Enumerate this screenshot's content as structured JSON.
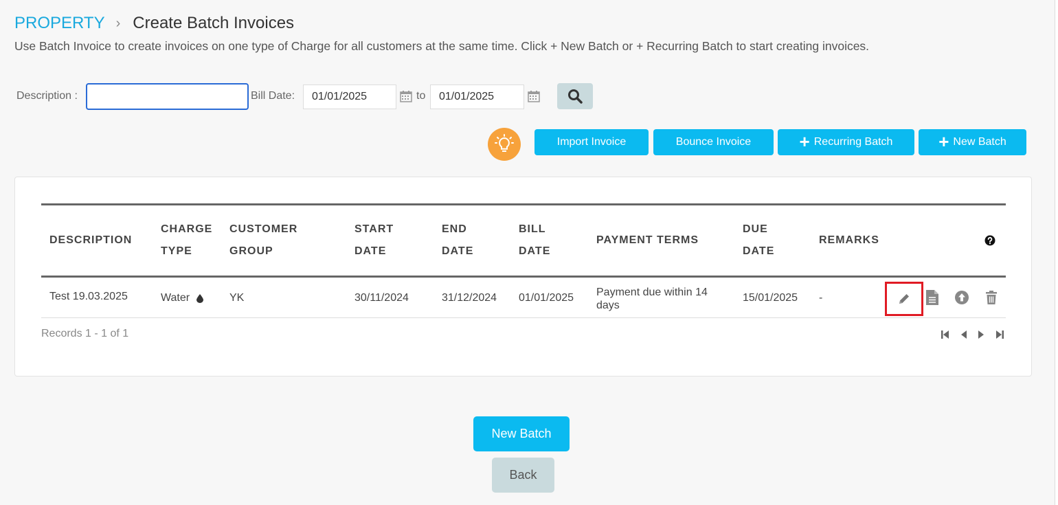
{
  "breadcrumb": {
    "root": "PROPERTY",
    "separator": "›",
    "current": "Create Batch Invoices"
  },
  "subtitle": "Use Batch Invoice to create invoices on one type of Charge for all customers at the same time. Click + New Batch or + Recurring Batch to start creating invoices.",
  "filters": {
    "description_label": "Description :",
    "description_value": "",
    "bill_date_label": "Bill Date:",
    "date_from": "01/01/2025",
    "to_label": "to",
    "date_to": "01/01/2025"
  },
  "toolbar": {
    "import_invoice": "Import Invoice",
    "bounce_invoice": "Bounce Invoice",
    "recurring_batch": "Recurring Batch",
    "new_batch": "New Batch"
  },
  "table": {
    "headers": {
      "description": "DESCRIPTION",
      "charge_type_1": "CHARGE",
      "charge_type_2": "TYPE",
      "customer_group_1": "CUSTOMER",
      "customer_group_2": "GROUP",
      "start_date_1": "START",
      "start_date_2": "DATE",
      "end_date_1": "END",
      "end_date_2": "DATE",
      "bill_date_1": "BILL",
      "bill_date_2": "DATE",
      "payment_terms": "PAYMENT TERMS",
      "due_date_1": "DUE",
      "due_date_2": "DATE",
      "remarks": "REMARKS"
    },
    "rows": [
      {
        "description": "Test 19.03.2025",
        "charge_type": "Water",
        "customer_group": "YK",
        "start_date": "30/11/2024",
        "end_date": "31/12/2024",
        "bill_date": "01/01/2025",
        "payment_terms_1": "Payment due within 14",
        "payment_terms_2": "days",
        "due_date": "15/01/2025",
        "remarks": "-"
      }
    ]
  },
  "records": "Records 1 - 1 of 1",
  "footer": {
    "new_batch": "New Batch",
    "back": "Back"
  },
  "colors": {
    "accent": "#0bbaf0",
    "link": "#1aa9de",
    "highlight": "#e01b24",
    "bulb": "#f7a23b"
  }
}
